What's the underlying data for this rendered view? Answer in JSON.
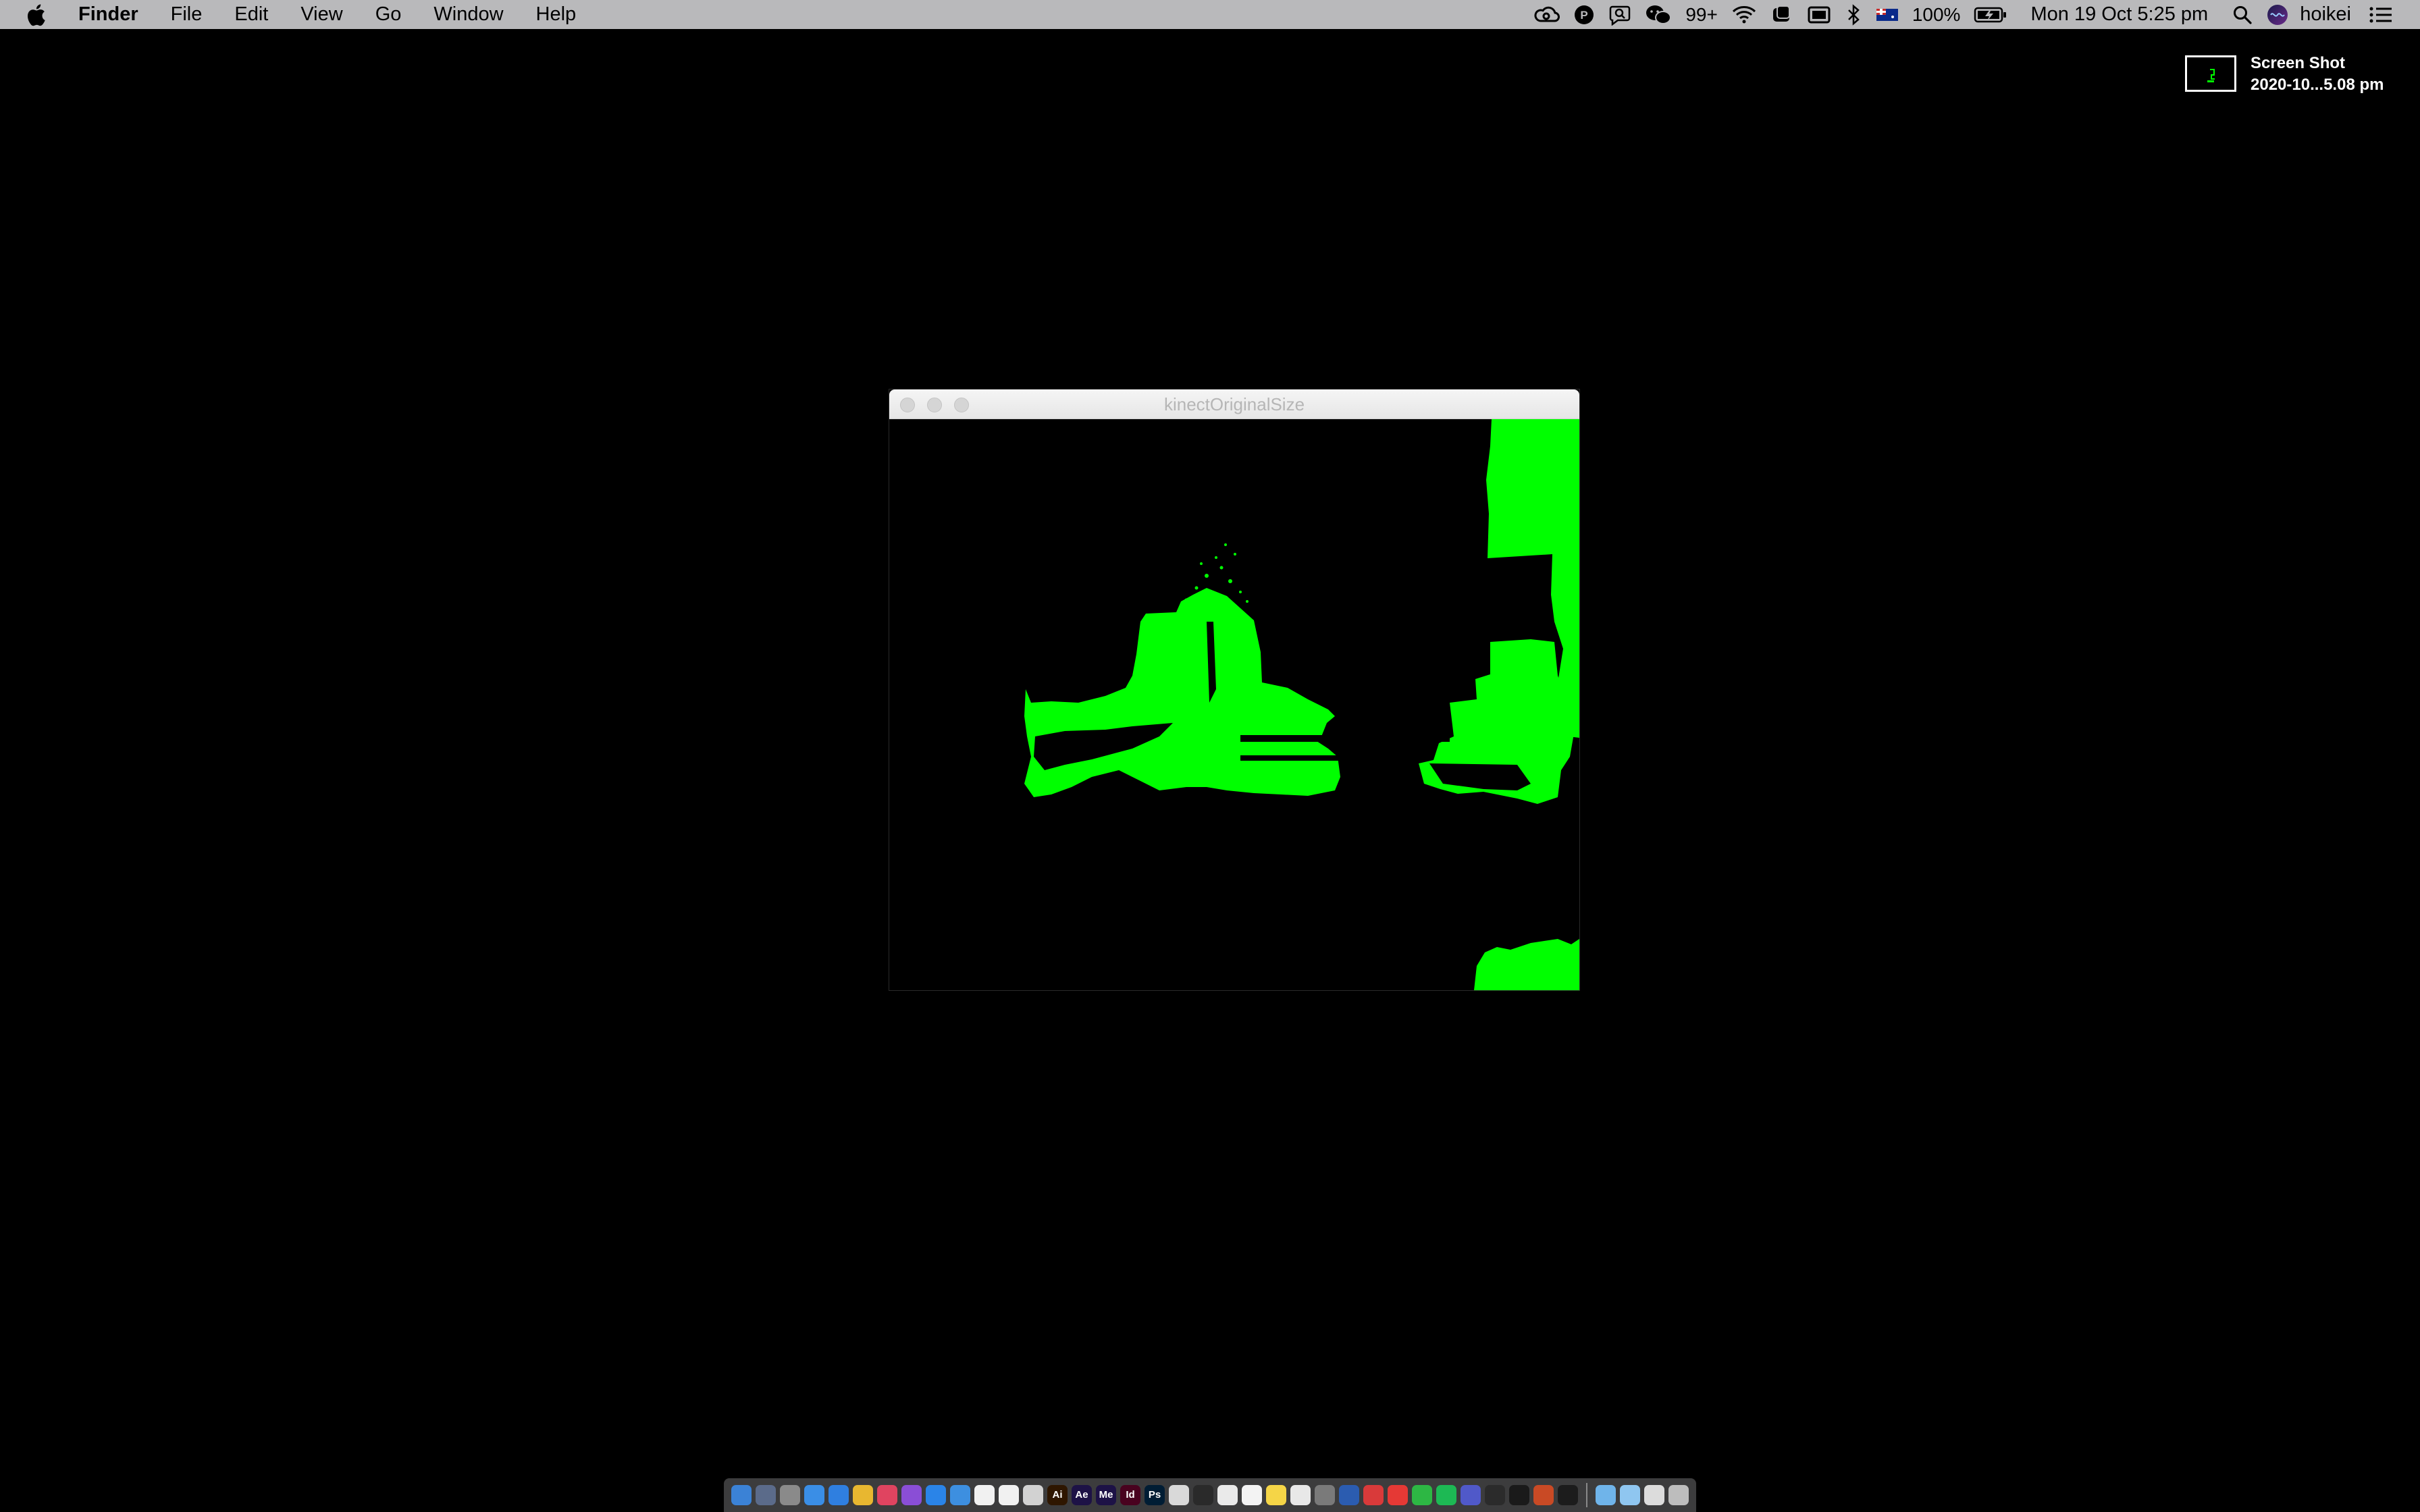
{
  "menubar": {
    "app_name": "Finder",
    "menus": [
      "File",
      "Edit",
      "View",
      "Go",
      "Window",
      "Help"
    ],
    "notification_count": "99+",
    "battery": "100%",
    "clock": "Mon 19 Oct  5:25 pm",
    "user": "hoikei"
  },
  "desktop_file": {
    "name_line1": "Screen Shot",
    "name_line2": "2020-10...5.08 pm"
  },
  "window": {
    "title": "kinectOriginalSize",
    "depth_color": "#00ff00"
  },
  "dock": {
    "apps": [
      {
        "icon": "finder-icon",
        "color": "#3b82d6",
        "label": ""
      },
      {
        "icon": "launchpad-icon",
        "color": "#5b6b8a",
        "label": ""
      },
      {
        "icon": "system-preferences-icon",
        "color": "#8a8a8a",
        "label": ""
      },
      {
        "icon": "safari-compass-icon",
        "color": "#3a8ee6",
        "label": ""
      },
      {
        "icon": "safari-icon",
        "color": "#2f7fe0",
        "label": ""
      },
      {
        "icon": "chrome-icon",
        "color": "#e8b730",
        "label": ""
      },
      {
        "icon": "music-icon",
        "color": "#e04460",
        "label": ""
      },
      {
        "icon": "podcasts-icon",
        "color": "#8a4ed6",
        "label": ""
      },
      {
        "icon": "app-store-icon",
        "color": "#2a84e8",
        "label": ""
      },
      {
        "icon": "mail-icon",
        "color": "#3d8fe0",
        "label": ""
      },
      {
        "icon": "notes-icon",
        "color": "#f1f1f1",
        "label": ""
      },
      {
        "icon": "calendar-icon",
        "color": "#f1f1f1",
        "label": ""
      },
      {
        "icon": "creative-cloud-icon",
        "color": "#d2d2d2",
        "label": ""
      },
      {
        "icon": "illustrator-icon",
        "color": "#2e1600",
        "label": "Ai"
      },
      {
        "icon": "after-effects-icon",
        "color": "#1d1246",
        "label": "Ae"
      },
      {
        "icon": "media-encoder-icon",
        "color": "#1d1246",
        "label": "Me"
      },
      {
        "icon": "indesign-icon",
        "color": "#49021f",
        "label": "Id"
      },
      {
        "icon": "photoshop-icon",
        "color": "#001d34",
        "label": "Ps"
      },
      {
        "icon": "qr-icon",
        "color": "#d9d9d9",
        "label": ""
      },
      {
        "icon": "processing-icon",
        "color": "#2a2a2a",
        "label": ""
      },
      {
        "icon": "acrobat-icon",
        "color": "#eaeaea",
        "label": ""
      },
      {
        "icon": "textedit-icon",
        "color": "#f3f3f3",
        "label": ""
      },
      {
        "icon": "stickies-icon",
        "color": "#f5d547",
        "label": ""
      },
      {
        "icon": "preview-icon",
        "color": "#e8e8e8",
        "label": ""
      },
      {
        "icon": "camera-icon",
        "color": "#7a7a7a",
        "label": ""
      },
      {
        "icon": "word-icon",
        "color": "#2b5cb0",
        "label": ""
      },
      {
        "icon": "netease-music-icon",
        "color": "#d93a3a",
        "label": ""
      },
      {
        "icon": "youdao-icon",
        "color": "#e53935",
        "label": ""
      },
      {
        "icon": "wechat-icon",
        "color": "#2db744",
        "label": ""
      },
      {
        "icon": "spotify-icon",
        "color": "#1db954",
        "label": ""
      },
      {
        "icon": "teams-icon",
        "color": "#5059c9",
        "label": ""
      },
      {
        "icon": "activity-monitor-icon",
        "color": "#2b2b2b",
        "label": ""
      },
      {
        "icon": "terminal-icon",
        "color": "#1a1a1a",
        "label": ""
      },
      {
        "icon": "powerpoint-icon",
        "color": "#c94a25",
        "label": ""
      },
      {
        "icon": "quicktime-icon",
        "color": "#1c1c1c",
        "label": ""
      }
    ],
    "stacks": [
      {
        "icon": "folder-icon",
        "color": "#6fb4ea"
      },
      {
        "icon": "downloads-folder-icon",
        "color": "#8fc6f0"
      },
      {
        "icon": "screenshot-stack-icon",
        "color": "#dcdcdc"
      },
      {
        "icon": "trash-icon",
        "color": "#bdbdbd"
      }
    ]
  }
}
